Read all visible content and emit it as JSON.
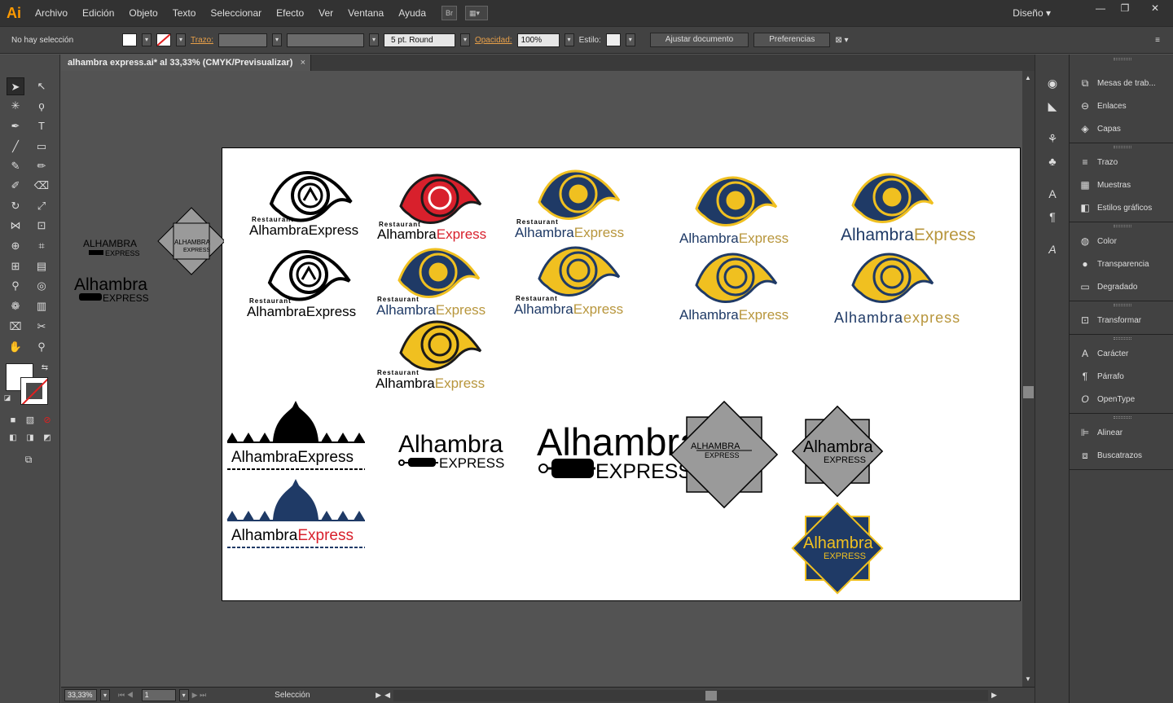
{
  "app": {
    "logo": "Ai"
  },
  "menu": [
    "Archivo",
    "Edición",
    "Objeto",
    "Texto",
    "Seleccionar",
    "Efecto",
    "Ver",
    "Ventana",
    "Ayuda"
  ],
  "menu_extras": {
    "bridge": "Br"
  },
  "workspace": {
    "label": "Diseño ▾"
  },
  "window_buttons": {
    "minimize": "—",
    "restore": "❐",
    "close": "✕"
  },
  "control": {
    "selection": "No hay selección",
    "stroke_label": "Trazo:",
    "brush": "5 pt. Round",
    "opacity_label": "Opacidad:",
    "opacity_value": "100%",
    "style_label": "Estilo:",
    "doc_setup": "Ajustar documento",
    "preferences": "Preferencias"
  },
  "document": {
    "tab": "alhambra express.ai* al 33,33% (CMYK/Previsualizar)",
    "close": "×"
  },
  "status": {
    "zoom": "33,33%",
    "artboard": "1",
    "tool": "Selección"
  },
  "artwork": {
    "restaurant": "Restaurant",
    "alhambra": "Alhambra",
    "express": "Express",
    "alhambra_express": "AlhambraExpress",
    "alhambra_caps": "ALHAMBRA",
    "express_caps": "EXPRESS",
    "alhambra_lower": "Alhambra",
    "express_lower": "express"
  },
  "colors": {
    "navy": "#1f3a66",
    "gold": "#f0c020",
    "red": "#d8202c",
    "olive": "#b8963c",
    "gray": "#9a9a9a"
  },
  "panels": [
    {
      "icon": "artboards-icon",
      "label": "Mesas de trab..."
    },
    {
      "icon": "links-icon",
      "label": "Enlaces"
    },
    {
      "icon": "layers-icon",
      "label": "Capas"
    },
    {
      "icon": "stroke-icon",
      "label": "Trazo"
    },
    {
      "icon": "swatches-icon",
      "label": "Muestras"
    },
    {
      "icon": "graphic-styles-icon",
      "label": "Estilos gráficos"
    },
    {
      "icon": "color-icon",
      "label": "Color"
    },
    {
      "icon": "transparency-icon",
      "label": "Transparencia"
    },
    {
      "icon": "gradient-icon",
      "label": "Degradado"
    },
    {
      "icon": "transform-icon",
      "label": "Transformar"
    },
    {
      "icon": "character-icon",
      "label": "Carácter"
    },
    {
      "icon": "paragraph-icon",
      "label": "Párrafo"
    },
    {
      "icon": "opentype-icon",
      "label": "OpenType"
    },
    {
      "icon": "align-icon",
      "label": "Alinear"
    },
    {
      "icon": "pathfinder-icon",
      "label": "Buscatrazos"
    }
  ]
}
